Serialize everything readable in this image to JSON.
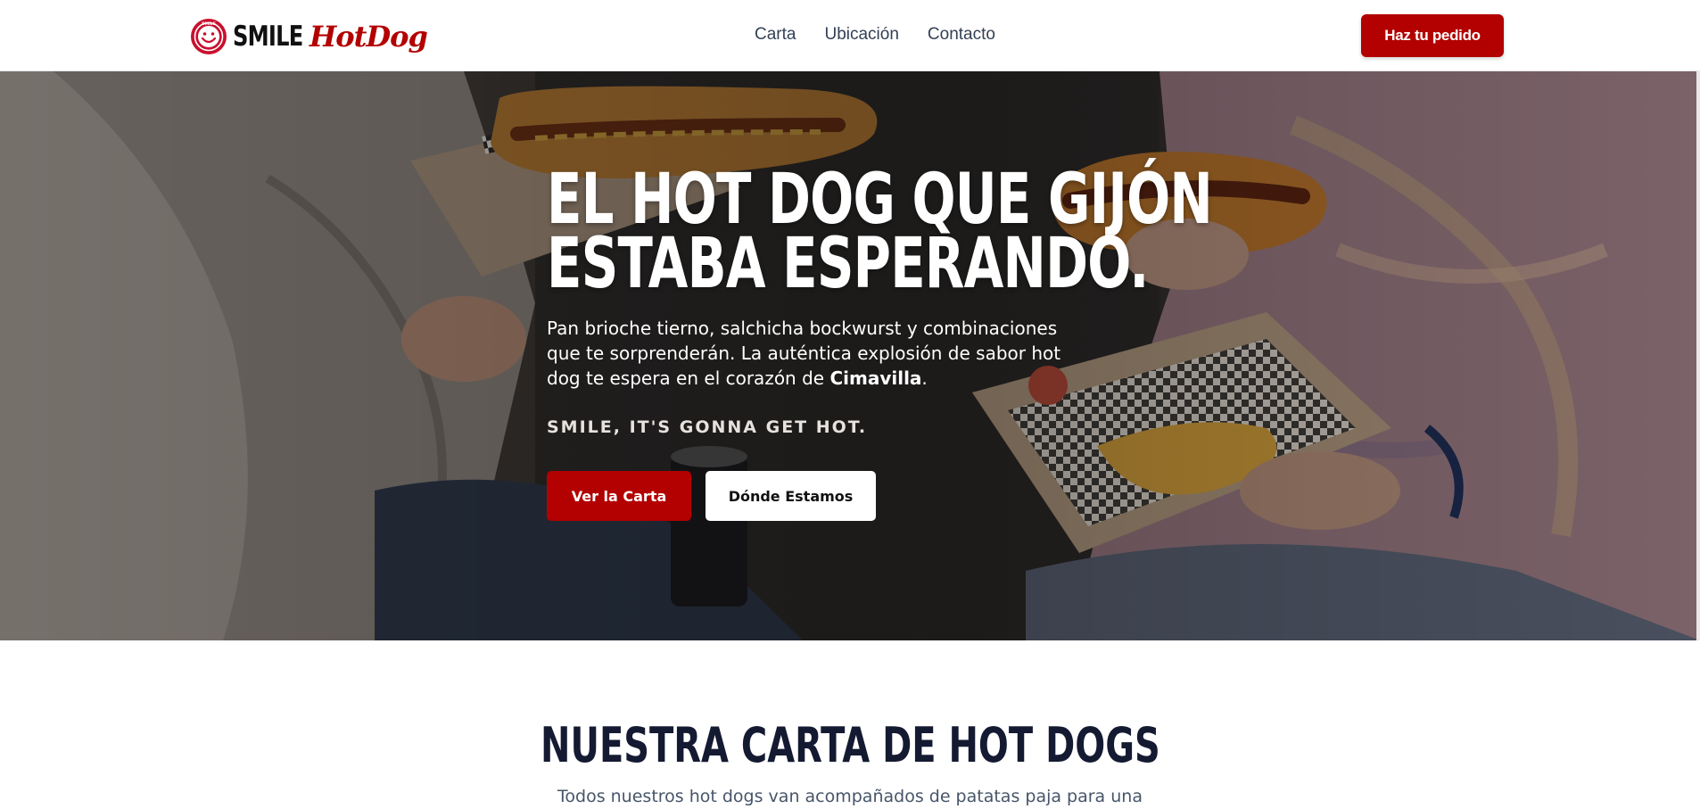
{
  "brand": {
    "word1": "SMILE",
    "word2": "HotDog",
    "badge_text": "SMILE"
  },
  "nav": {
    "items": [
      {
        "label": "Carta"
      },
      {
        "label": "Ubicación"
      },
      {
        "label": "Contacto"
      }
    ],
    "cta_label": "Haz tu pedido"
  },
  "hero": {
    "title_line1": "EL HOT DOG QUE GIJÓN",
    "title_line2": "ESTABA ESPERANDO.",
    "description_before": "Pan brioche tierno, salchicha bockwurst y combinaciones que te sorprenderán. La auténtica explosión de sabor hot dog te espera en el corazón de ",
    "description_highlight": "Cimavilla",
    "description_after": ".",
    "tagline": "SMILE, IT'S GONNA GET HOT.",
    "primary_button": "Ver la Carta",
    "secondary_button": "Dónde Estamos"
  },
  "menu": {
    "title": "NUESTRA CARTA DE HOT DOGS",
    "subtitle": "Todos nuestros hot dogs van acompañados de patatas paja para una"
  },
  "colors": {
    "brand_red": "#b30000",
    "navy": "#141a31",
    "nav_text": "#334155"
  }
}
